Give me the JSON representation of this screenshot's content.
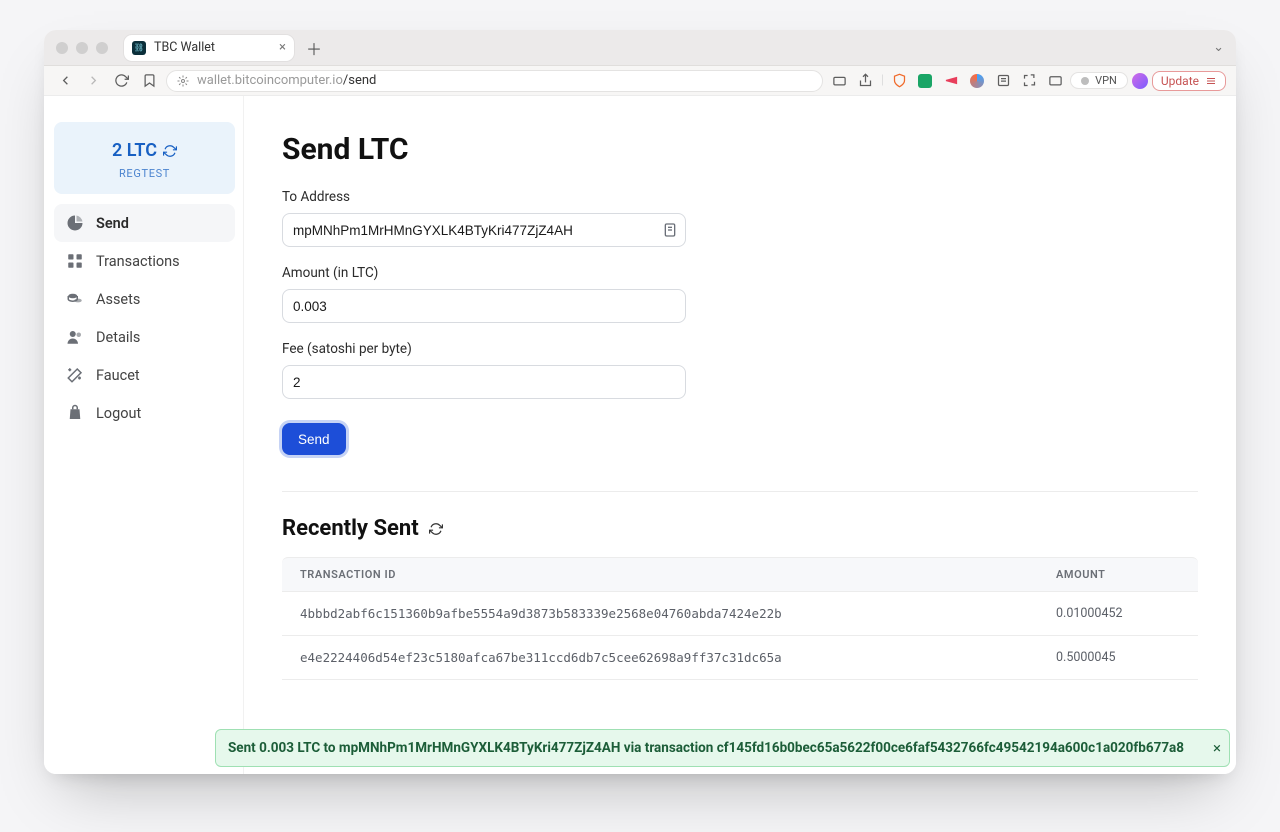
{
  "browser": {
    "tab_title": "TBC Wallet",
    "url_host": "wallet.bitcoincomputer.io",
    "url_path": "/send",
    "vpn_label": "VPN",
    "update_label": "Update"
  },
  "sidebar": {
    "balance": "2 LTC",
    "network": "REGTEST",
    "items": [
      {
        "label": "Send"
      },
      {
        "label": "Transactions"
      },
      {
        "label": "Assets"
      },
      {
        "label": "Details"
      },
      {
        "label": "Faucet"
      },
      {
        "label": "Logout"
      }
    ]
  },
  "send_form": {
    "heading": "Send LTC",
    "to_label": "To Address",
    "to_value": "mpMNhPm1MrHMnGYXLK4BTyKri477ZjZ4AH",
    "amount_label": "Amount (in LTC)",
    "amount_value": "0.003",
    "fee_label": "Fee (satoshi per byte)",
    "fee_value": "2",
    "submit_label": "Send"
  },
  "recent": {
    "heading": "Recently Sent",
    "columns": {
      "id": "TRANSACTION ID",
      "amount": "AMOUNT"
    },
    "rows": [
      {
        "tx": "4bbbd2abf6c151360b9afbe5554a9d3873b583339e2568e04760abda7424e22b",
        "amount": "0.01000452"
      },
      {
        "tx": "e4e2224406d54ef23c5180afca67be311ccd6db7c5cee62698a9ff37c31dc65a",
        "amount": "0.5000045"
      }
    ]
  },
  "toast": {
    "message": "Sent 0.003 LTC to mpMNhPm1MrHMnGYXLK4BTyKri477ZjZ4AH via transaction cf145fd16b0bec65a5622f00ce6faf5432766fc49542194a600c1a020fb677a8"
  }
}
